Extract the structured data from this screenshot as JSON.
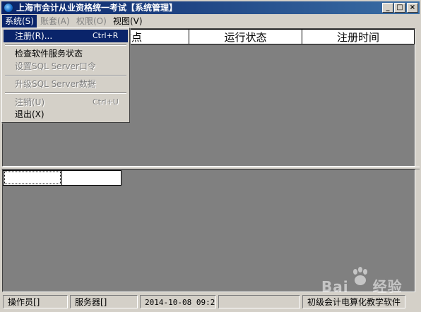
{
  "window": {
    "title": "上海市会计从业资格统一考试【系统管理】",
    "controls": {
      "minimize": "_",
      "maximize": "□",
      "close": "×"
    }
  },
  "menubar": {
    "items": [
      {
        "label": "系统(S)",
        "state": "active"
      },
      {
        "label": "账套(A)",
        "state": "disabled"
      },
      {
        "label": "权限(O)",
        "state": "disabled"
      },
      {
        "label": "视图(V)",
        "state": "enabled"
      }
    ]
  },
  "system_menu": {
    "items": [
      {
        "label": "注册(R)...",
        "shortcut": "Ctrl+R"
      },
      {
        "label": "检查软件服务状态",
        "shortcut": ""
      },
      {
        "label": "设置SQL Server口令",
        "shortcut": ""
      },
      {
        "label": "升级SQL Server数据",
        "shortcut": ""
      },
      {
        "label": "注销(U)",
        "shortcut": "Ctrl+U"
      },
      {
        "label": "退出(X)",
        "shortcut": ""
      }
    ]
  },
  "grid": {
    "columns": [
      "站点",
      "运行状态",
      "注册时间"
    ]
  },
  "statusbar": {
    "operator": "操作员[]",
    "server": "服务器[]",
    "datetime": "2014-10-08 09:27",
    "product": "初级会计电算化教学软件"
  },
  "watermark": {
    "text": "Bai",
    "text2": "经验"
  },
  "colors": {
    "titlebar_start": "#0a246a",
    "titlebar_end": "#3a6ea5",
    "client_bg": "#808080",
    "menu_highlight": "#0a246a"
  }
}
